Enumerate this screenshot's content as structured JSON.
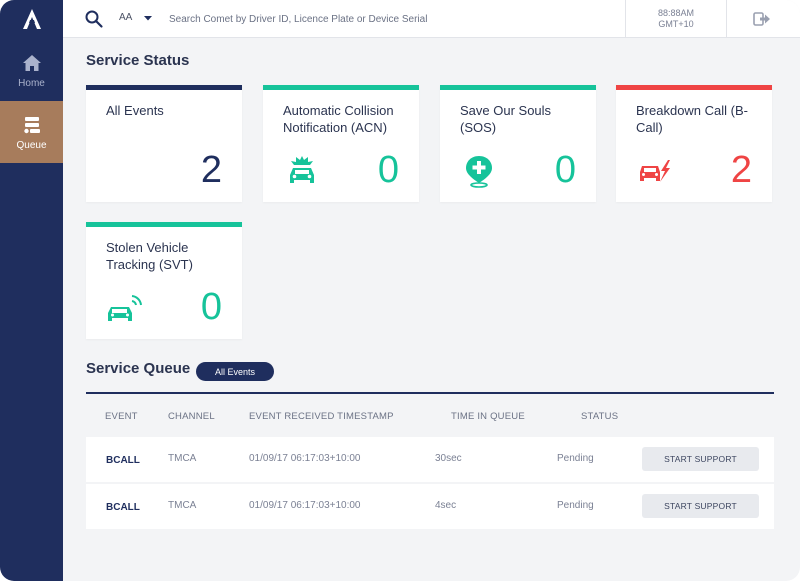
{
  "sidebar": {
    "items": [
      {
        "label": "Home",
        "icon": "home-icon"
      },
      {
        "label": "Queue",
        "icon": "queue-icon"
      }
    ]
  },
  "topbar": {
    "org": "AA",
    "search_placeholder": "Search Comet by Driver ID, Licence Plate or Device Serial",
    "time": "88:88AM",
    "timezone": "GMT+10"
  },
  "service_status": {
    "title": "Service Status",
    "cards": [
      {
        "label": "All Events",
        "count": "2",
        "color": "#1f2e5e"
      },
      {
        "label": "Automatic Collision Notification (ACN)",
        "count": "0",
        "icon": "car-crash-icon",
        "color": "#16c39a"
      },
      {
        "label": "Save Our Souls (SOS)",
        "count": "0",
        "icon": "medical-pin-icon",
        "color": "#16c39a"
      },
      {
        "label": "Breakdown Call (B-Call)",
        "count": "2",
        "icon": "car-breakdown-icon",
        "color": "#ef4444"
      },
      {
        "label": "Stolen Vehicle Tracking (SVT)",
        "count": "0",
        "icon": "car-tracking-icon",
        "color": "#16c39a"
      }
    ]
  },
  "service_queue": {
    "title": "Service Queue",
    "filter": "All Events",
    "columns": [
      "EVENT",
      "CHANNEL",
      "EVENT RECEIVED TIMESTAMP",
      "TIME IN QUEUE",
      "STATUS"
    ],
    "rows": [
      {
        "event": "BCALL",
        "channel": "TMCA",
        "timestamp": "01/09/17 06:17:03+10:00",
        "time_in_queue": "30sec",
        "status": "Pending",
        "action": "START SUPPORT"
      },
      {
        "event": "BCALL",
        "channel": "TMCA",
        "timestamp": "01/09/17 06:17:03+10:00",
        "time_in_queue": "4sec",
        "status": "Pending",
        "action": "START SUPPORT"
      }
    ]
  }
}
